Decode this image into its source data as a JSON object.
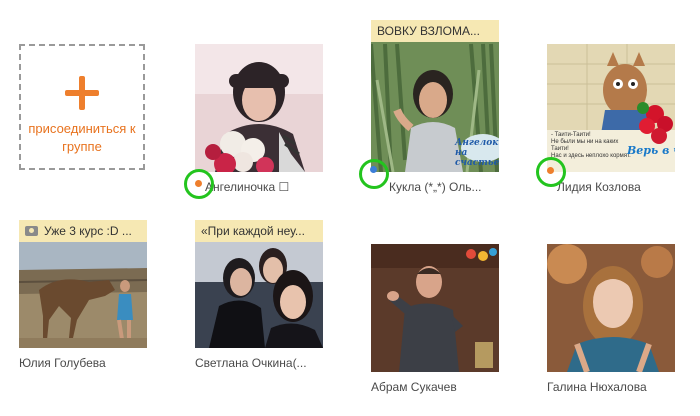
{
  "join": {
    "label": "присоединиться к группе"
  },
  "members": [
    {
      "name": "Ангелиночка ☐",
      "status": "",
      "online": "orange",
      "highlighted": true
    },
    {
      "name": "Кукла (*„*) Оль...",
      "status": "ВОВКУ ВЗЛОМА...",
      "online": "blue",
      "highlighted": true,
      "sticker": "Ангелок на счастье"
    },
    {
      "name": "Лидия Козлова",
      "status": "",
      "online": "orange",
      "highlighted": true,
      "sticker": "Верь в чудеса!",
      "note_lines": [
        "- Таити-Таити!",
        "Не были мы ни на каких Таити!",
        "Нас и здесь неплохо кормят."
      ]
    },
    {
      "name": "Юлия Голубева",
      "status": "Уже 3 курс :D ...",
      "status_icon": "camera-icon"
    },
    {
      "name": "Светлана Очкина(...",
      "status": "«При каждой неу..."
    },
    {
      "name": "Абрам Сукачев",
      "status": ""
    },
    {
      "name": "Галина Нюхалова",
      "status": ""
    }
  ],
  "colors": {
    "accent": "#ee7f2d",
    "status_bg": "#f6e8b3",
    "highlight": "#23c41e",
    "online_blue": "#3b7ed8",
    "online_orange": "#ee7f2d"
  }
}
